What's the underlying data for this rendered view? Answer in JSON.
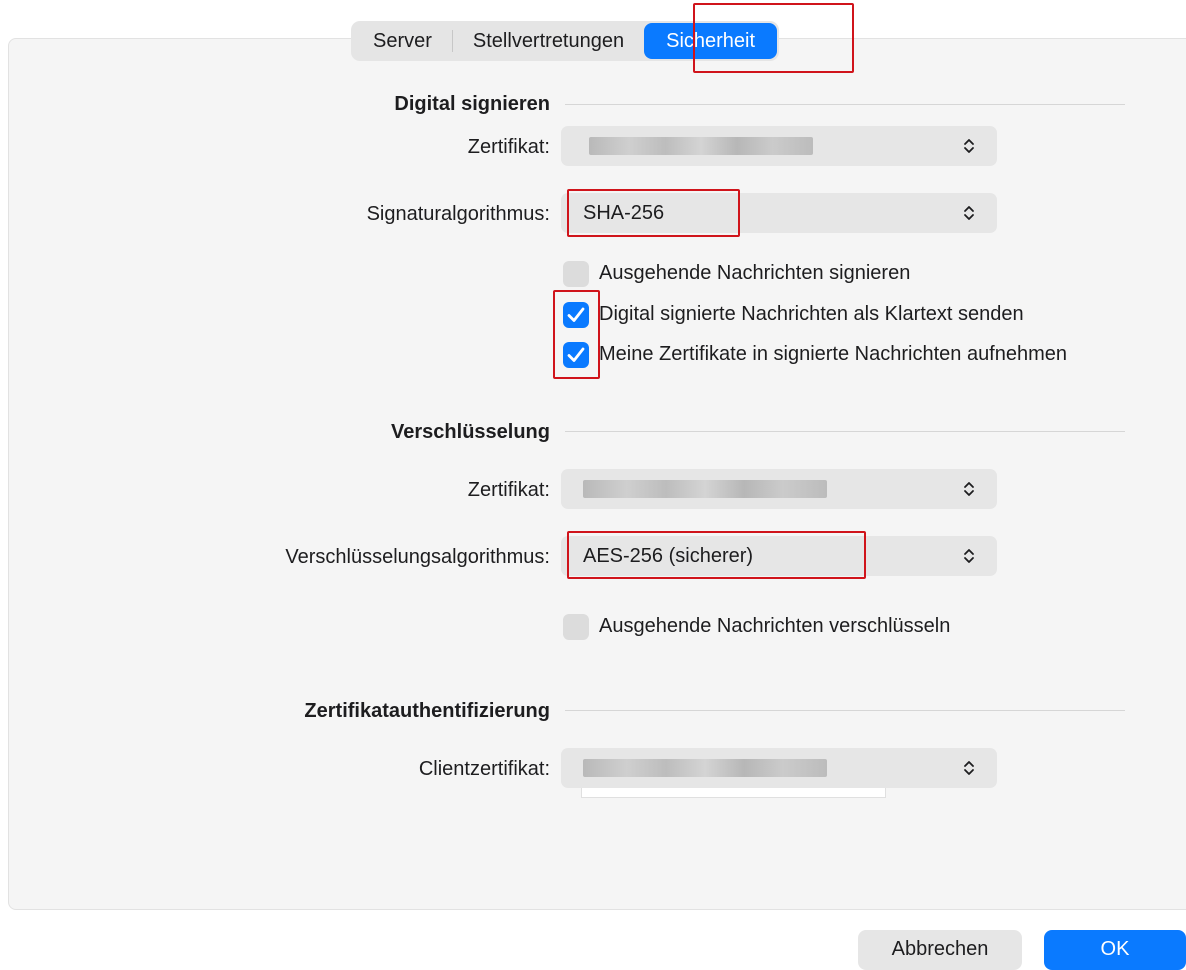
{
  "tabs": [
    {
      "label": "Server",
      "active": false
    },
    {
      "label": "Stellvertretungen",
      "active": false
    },
    {
      "label": "Sicherheit",
      "active": true
    }
  ],
  "digital_sign": {
    "title": "Digital signieren",
    "certificate_label": "Zertifikat:",
    "algorithm_label": "Signaturalgorithmus:",
    "algorithm_value": "SHA-256",
    "options": [
      {
        "label": "Ausgehende Nachrichten signieren",
        "checked": false
      },
      {
        "label": "Digital signierte Nachrichten als Klartext senden",
        "checked": true
      },
      {
        "label": "Meine Zertifikate in signierte Nachrichten aufnehmen",
        "checked": true
      }
    ]
  },
  "encryption": {
    "title": "Verschlüsselung",
    "certificate_label": "Zertifikat:",
    "algorithm_label": "Verschlüsselungsalgorithmus:",
    "algorithm_value": "AES-256 (sicherer)",
    "options": [
      {
        "label": "Ausgehende Nachrichten verschlüsseln",
        "checked": false
      }
    ]
  },
  "cert_auth": {
    "title": "Zertifikatauthentifizierung",
    "client_cert_label": "Clientzertifikat:"
  },
  "footer": {
    "cancel_label": "Abbrechen",
    "ok_label": "OK"
  },
  "colors": {
    "accent": "#0a7aff",
    "highlight": "#d0141b",
    "panel": "#f5f5f5"
  },
  "icons": {
    "popup": "chevron-up-down-icon",
    "checkbox_checked": "checkmark-icon"
  }
}
